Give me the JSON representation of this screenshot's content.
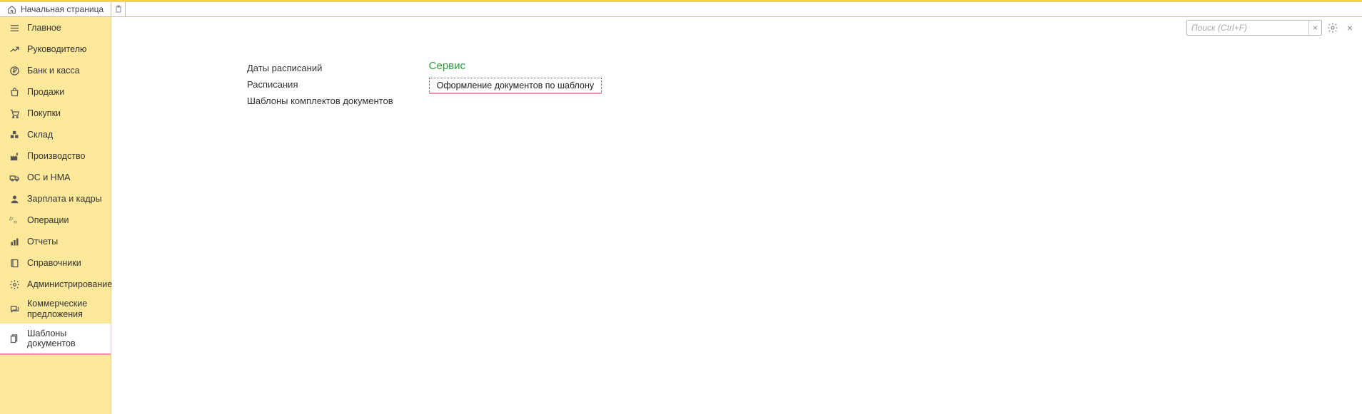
{
  "tabs": {
    "home": "Начальная страница"
  },
  "sidebar": {
    "items": [
      {
        "label": "Главное"
      },
      {
        "label": "Руководителю"
      },
      {
        "label": "Банк и касса"
      },
      {
        "label": "Продажи"
      },
      {
        "label": "Покупки"
      },
      {
        "label": "Склад"
      },
      {
        "label": "Производство"
      },
      {
        "label": "ОС и НМА"
      },
      {
        "label": "Зарплата и кадры"
      },
      {
        "label": "Операции"
      },
      {
        "label": "Отчеты"
      },
      {
        "label": "Справочники"
      },
      {
        "label": "Администрирование"
      },
      {
        "label": "Коммерческие предложения"
      },
      {
        "label": "Шаблоны документов"
      }
    ]
  },
  "header": {
    "search_placeholder": "Поиск (Ctrl+F)",
    "clear": "×",
    "close": "×"
  },
  "content": {
    "links": [
      "Даты расписаний",
      "Расписания",
      "Шаблоны комплектов документов"
    ],
    "service_title": "Сервис",
    "service_button": "Оформление документов по шаблону"
  }
}
